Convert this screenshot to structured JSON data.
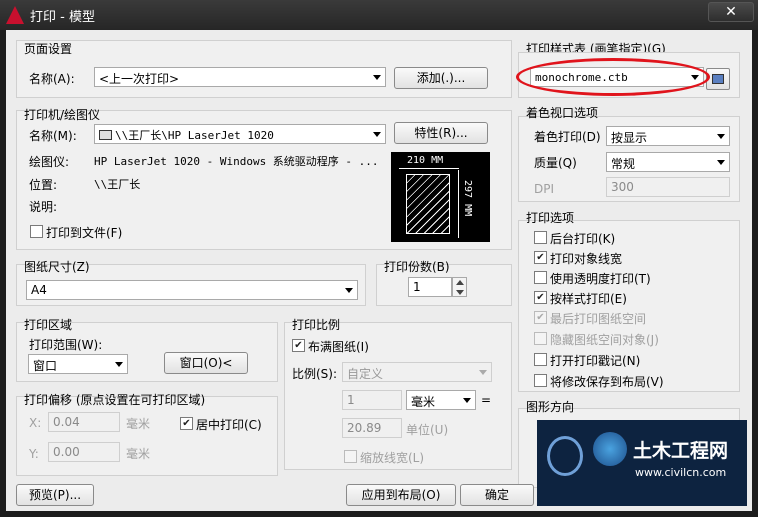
{
  "window": {
    "title": "打印 - 模型",
    "close": "✕"
  },
  "page_setup": {
    "group": "页面设置",
    "name_label": "名称(A):",
    "name_value": "<上一次打印>",
    "add_button": "添加(.)..."
  },
  "plotter": {
    "group": "打印机/绘图仪",
    "name_label": "名称(M):",
    "name_value": "\\\\王厂长\\HP LaserJet 1020",
    "props_button": "特性(R)...",
    "plotter_label": "绘图仪:",
    "plotter_value": "HP LaserJet 1020 - Windows 系统驱动程序 - ...",
    "location_label": "位置:",
    "location_value": "\\\\王厂长",
    "desc_label": "说明:",
    "plot_to_file": "打印到文件(F)",
    "preview_width": "210 MM",
    "preview_height": "297 MM"
  },
  "paper_size": {
    "group": "图纸尺寸(Z)",
    "value": "A4"
  },
  "copies": {
    "group": "打印份数(B)",
    "value": "1"
  },
  "plot_area": {
    "group": "打印区域",
    "what_label": "打印范围(W):",
    "what_value": "窗口",
    "window_button": "窗口(O)<"
  },
  "plot_offset": {
    "group": "打印偏移 (原点设置在可打印区域)",
    "x_label": "X:",
    "x_value": "0.04",
    "x_unit": "毫米",
    "y_label": "Y:",
    "y_value": "0.00",
    "y_unit": "毫米",
    "center": "居中打印(C)"
  },
  "plot_scale": {
    "group": "打印比例",
    "fit": "布满图纸(I)",
    "scale_label": "比例(S):",
    "scale_value": "自定义",
    "num": "1",
    "unit": "毫米",
    "eq": "=",
    "den": "20.89",
    "den_unit": "单位(U)",
    "lineweights": "缩放线宽(L)"
  },
  "style_table": {
    "group": "打印样式表 (画笔指定)(G)",
    "value": "monochrome.ctb"
  },
  "shaded": {
    "group": "着色视口选项",
    "shade_label": "着色打印(D)",
    "shade_value": "按显示",
    "quality_label": "质量(Q)",
    "quality_value": "常规",
    "dpi_label": "DPI",
    "dpi_value": "300"
  },
  "options": {
    "group": "打印选项",
    "items": [
      "后台打印(K)",
      "打印对象线宽",
      "使用透明度打印(T)",
      "按样式打印(E)",
      "最后打印图纸空间",
      "隐藏图纸空间对象(J)",
      "打开打印戳记(N)",
      "将修改保存到布局(V)"
    ]
  },
  "orientation": {
    "group": "图形方向"
  },
  "footer": {
    "preview": "预览(P)...",
    "apply": "应用到布局(O)",
    "ok": "确定"
  },
  "watermark": {
    "name": "土木工程网",
    "url": "www.civilcn.com"
  },
  "colors": {
    "annotation": "#e0141c",
    "titlebar": "#2e2e2e",
    "dialog": "#f0f0f0"
  }
}
